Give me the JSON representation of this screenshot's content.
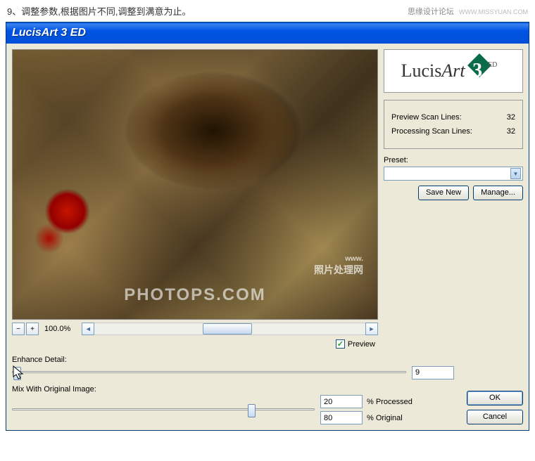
{
  "header": {
    "instruction": "9、调整参数,根据图片不同,调整到满意为止。",
    "forum_name": "思缘设计论坛",
    "forum_url": "WWW.MISSYUAN.COM"
  },
  "window": {
    "title": "LucisArt 3 ED"
  },
  "logo": {
    "brand_a": "Lucis",
    "brand_b": "Art",
    "version": "3",
    "edition": "ED"
  },
  "info": {
    "preview_lines_label": "Preview Scan Lines:",
    "preview_lines_value": "32",
    "processing_lines_label": "Processing Scan Lines:",
    "processing_lines_value": "32"
  },
  "preset": {
    "label": "Preset:",
    "save_new": "Save New",
    "manage": "Manage..."
  },
  "zoom": {
    "minus": "−",
    "plus": "+",
    "percent": "100.0%"
  },
  "preview_check": {
    "label": "Preview",
    "checked": true
  },
  "enhance": {
    "label": "Enhance Detail:",
    "value": "9"
  },
  "mix": {
    "label": "Mix With Original Image:",
    "processed_value": "20",
    "processed_label": "% Processed",
    "original_value": "80",
    "original_label": "% Original"
  },
  "actions": {
    "ok": "OK",
    "cancel": "Cancel"
  },
  "watermark": {
    "line1_pre": "www.",
    "line1": "照片处理网",
    "line2": "PHOTOPS.COM"
  }
}
